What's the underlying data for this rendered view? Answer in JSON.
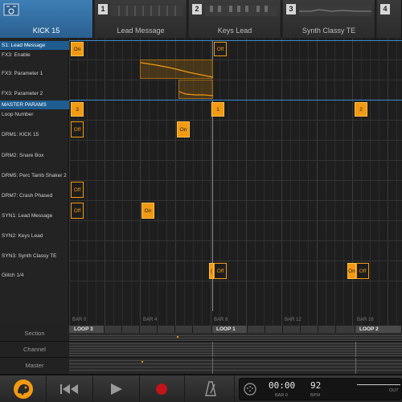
{
  "tabs": [
    {
      "label": "KICK 15",
      "num": "",
      "active": true
    },
    {
      "label": "Lead Message",
      "num": "1"
    },
    {
      "label": "Keys Lead",
      "num": "2"
    },
    {
      "label": "Synth Classy TE",
      "num": "3"
    },
    {
      "label": "",
      "num": "4"
    }
  ],
  "rows": {
    "s1": "S1: Lead Message",
    "fx3_enable": "FX3: Enable",
    "fx3_p1": "FX3: Parameter 1",
    "fx3_p2": "FX3: Parameter 2",
    "master": "MASTER PARAMS",
    "loop_number": "Loop Number",
    "drm1": "DRM1: KICK 15",
    "drm2": "DRM2: Snare Box",
    "drm5": "DRM5: Perc Tamb Shaker 2",
    "drm7": "DRM7: Crash Phased",
    "syn1": "SYN1: Lead Message",
    "syn2": "SYN2: Keys Lead",
    "syn3": "SYN3: Synth Classy TE",
    "glitch": "Glitch 1/4"
  },
  "events": {
    "on": "On",
    "off": "Off",
    "loop3": "3",
    "loop1": "1",
    "loop2": "2",
    "partial_a": "(",
    "partial_b": "On"
  },
  "bars": [
    "BAR 0",
    "BAR 4",
    "BAR 8",
    "BAR 12",
    "BAR 16"
  ],
  "lanes": {
    "section": "Section",
    "channel": "Channel",
    "master": "Master",
    "loops": [
      "LOOP 3",
      "LOOP 1",
      "LOOP 2"
    ]
  },
  "transport": {
    "time": "00:00",
    "bar_value": "BAR 0",
    "tempo": "92",
    "bpm": "BPM",
    "out": "OUT"
  },
  "colors": {
    "accent": "#f29a12",
    "selected": "#1f5d90"
  }
}
